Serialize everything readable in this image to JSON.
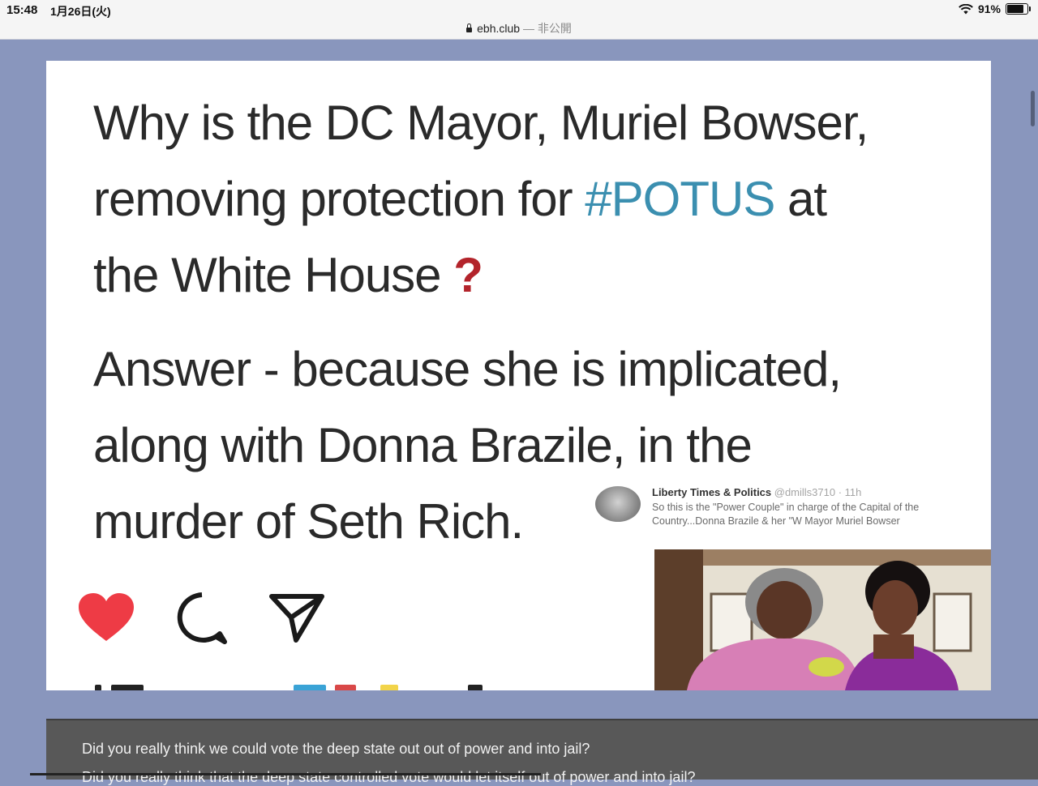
{
  "status_bar": {
    "time": "15:48",
    "date": "1月26日(火)",
    "battery": "91%",
    "battery_level": 0.91
  },
  "url_bar": {
    "domain": "ebh.club",
    "separator": "— ",
    "mode": "非公開"
  },
  "meme": {
    "line1": "Why is the DC Mayor, Muriel Bowser,",
    "line2_prefix": "removing protection for ",
    "hashtag": "#POTUS",
    "line2_suffix": " at",
    "line3": "the White House ",
    "question_mark": "?",
    "answer_line1": "Answer - because she is implicated,",
    "answer_line2": "along with Donna Brazile, in the",
    "answer_line3": "murder of Seth Rich."
  },
  "tweet": {
    "name": "Liberty Times & Politics",
    "handle_time": " @dmills3710 · 11h",
    "text": "So this is the \"Power Couple\" in charge of the Capital of the Country...Donna Brazile & her \"W Mayor Muriel Bowser"
  },
  "icons": {
    "like": "heart-icon",
    "comment": "comment-icon",
    "share": "send-icon"
  },
  "colors": {
    "hashtag": "#3b8fb0",
    "question_mark": "#b3242b",
    "heart": "#ee3b45",
    "page_background": "#8996bd"
  },
  "comment": {
    "line1": "Did you really think we could vote the deep state out out of power and into jail?",
    "line2": "Did you really think that the deep state controlled vote would let itself out of power and into jail?"
  }
}
